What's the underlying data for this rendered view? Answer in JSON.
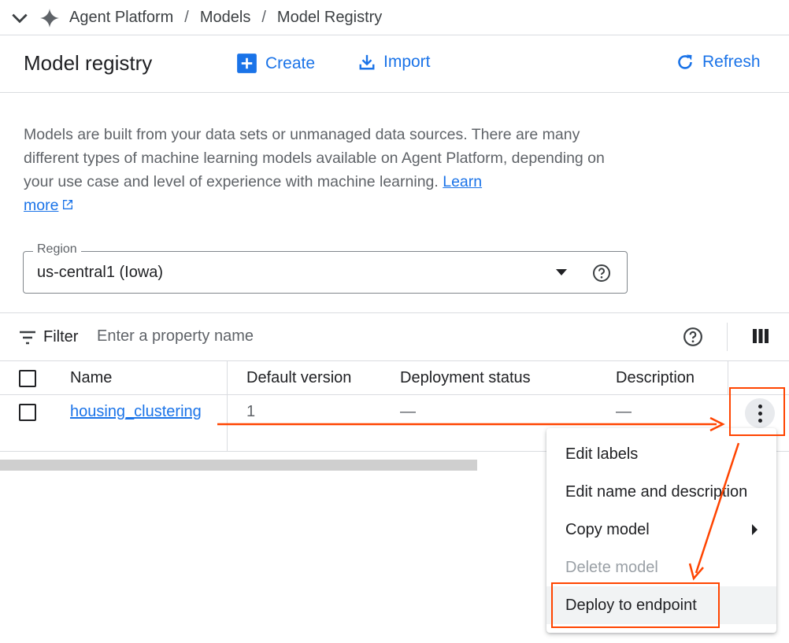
{
  "breadcrumb": {
    "items": [
      "Agent Platform",
      "Models",
      "Model Registry"
    ],
    "separator": "/"
  },
  "header": {
    "title": "Model registry",
    "create_label": "Create",
    "import_label": "Import",
    "refresh_label": "Refresh"
  },
  "description": {
    "text": "Models are built from your data sets or unmanaged data sources. There are many different types of machine learning models available on Agent Platform, depending on your use case and level of experience with machine learning.",
    "link_text_1": "Learn",
    "link_text_2": "more"
  },
  "region": {
    "label": "Region",
    "value": "us-central1 (Iowa)"
  },
  "filter": {
    "label": "Filter",
    "placeholder": "Enter a property name"
  },
  "table": {
    "columns": [
      "Name",
      "Default version",
      "Deployment status",
      "Description"
    ],
    "rows": [
      {
        "name": "housing_clustering",
        "default_version": "1",
        "deployment_status": "—",
        "description": "—"
      }
    ]
  },
  "menu": {
    "items": [
      {
        "label": "Edit labels",
        "disabled": false
      },
      {
        "label": "Edit name and description",
        "disabled": false
      },
      {
        "label": "Copy model",
        "disabled": false,
        "submenu": true
      },
      {
        "label": "Delete model",
        "disabled": true
      },
      {
        "label": "Deploy to endpoint",
        "disabled": false
      }
    ]
  },
  "colors": {
    "accent": "#1a73e8",
    "annotation": "#ff4400",
    "text": "#202124",
    "muted": "#5f6368",
    "border": "#dadce0"
  },
  "icons": [
    "chevron-down-icon",
    "sparkle-icon",
    "add-box-icon",
    "download-icon",
    "refresh-icon",
    "external-link-icon",
    "help-icon",
    "filter-icon",
    "columns-icon",
    "more-vert-icon",
    "arrow-right-icon"
  ]
}
